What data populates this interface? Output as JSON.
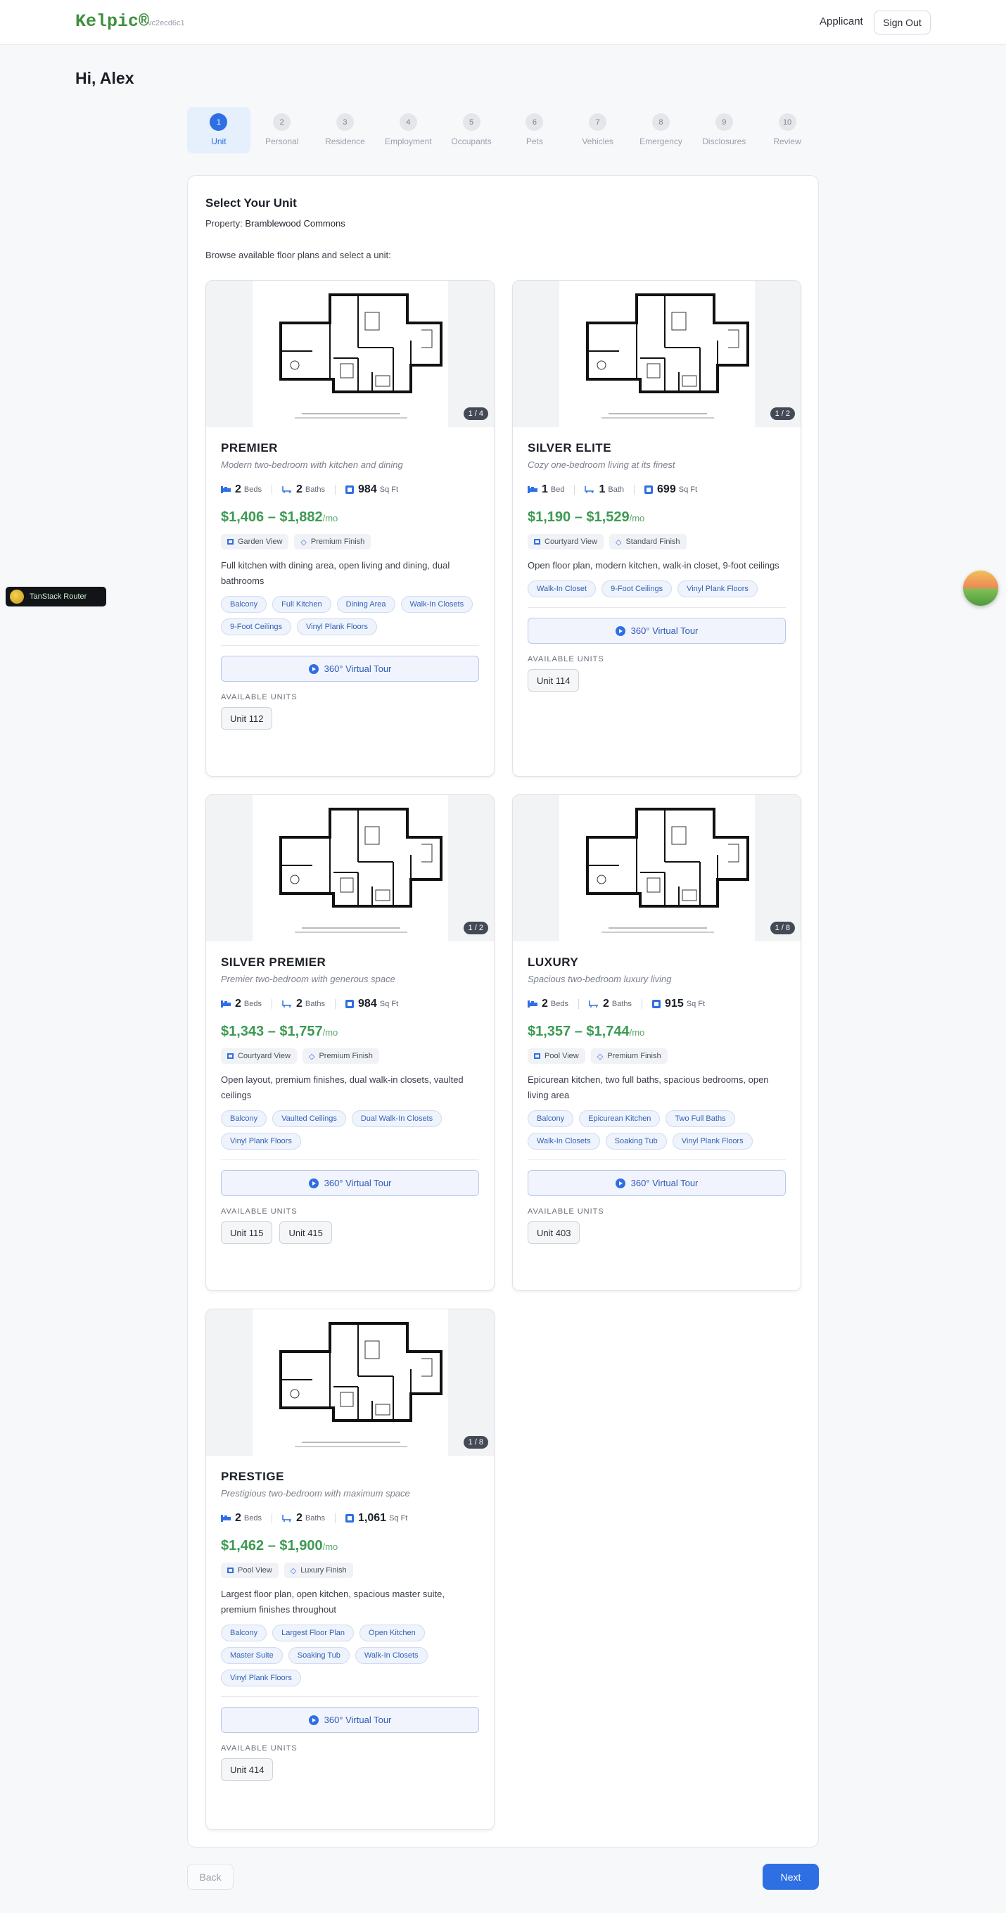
{
  "header": {
    "brand": "Kelpic®",
    "version": "vc2ecd6c1",
    "applicant_label": "Applicant",
    "signout_label": "Sign Out"
  },
  "greeting": "Hi, Alex",
  "steps": [
    {
      "num": "1",
      "label": "Unit"
    },
    {
      "num": "2",
      "label": "Personal"
    },
    {
      "num": "3",
      "label": "Residence"
    },
    {
      "num": "4",
      "label": "Employment"
    },
    {
      "num": "5",
      "label": "Occupants"
    },
    {
      "num": "6",
      "label": "Pets"
    },
    {
      "num": "7",
      "label": "Vehicles"
    },
    {
      "num": "8",
      "label": "Emergency"
    },
    {
      "num": "9",
      "label": "Disclosures"
    },
    {
      "num": "10",
      "label": "Review"
    }
  ],
  "panel": {
    "title": "Select Your Unit",
    "property_label": "Property:",
    "property_name": "Bramblewood Commons",
    "browse_text": "Browse available floor plans and select a unit:"
  },
  "labels": {
    "beds": "Beds",
    "bed": "Bed",
    "baths": "Baths",
    "bath": "Bath",
    "sqft": "Sq Ft",
    "per_month": "/mo",
    "tour": "360° Virtual Tour",
    "available": "AVAILABLE UNITS"
  },
  "cards": [
    {
      "img_count": "1 / 4",
      "name": "PREMIER",
      "tagline": "Modern two-bedroom with kitchen and dining",
      "beds": "2",
      "beds_label": "Beds",
      "baths": "2",
      "baths_label": "Baths",
      "sqft": "984",
      "price": "$1,406 – $1,882",
      "view": "Garden View",
      "finish": "Premium Finish",
      "description": "Full kitchen with dining area, open living and dining, dual bathrooms",
      "amenities": [
        "Balcony",
        "Full Kitchen",
        "Dining Area",
        "Walk-In Closets",
        "9-Foot Ceilings",
        "Vinyl Plank Floors"
      ],
      "units": [
        "Unit 112"
      ]
    },
    {
      "img_count": "1 / 2",
      "name": "SILVER ELITE",
      "tagline": "Cozy one-bedroom living at its finest",
      "beds": "1",
      "beds_label": "Bed",
      "baths": "1",
      "baths_label": "Bath",
      "sqft": "699",
      "price": "$1,190 – $1,529",
      "view": "Courtyard View",
      "finish": "Standard Finish",
      "description": "Open floor plan, modern kitchen, walk-in closet, 9-foot ceilings",
      "amenities": [
        "Walk-In Closet",
        "9-Foot Ceilings",
        "Vinyl Plank Floors"
      ],
      "units": [
        "Unit 114"
      ]
    },
    {
      "img_count": "1 / 2",
      "name": "SILVER PREMIER",
      "tagline": "Premier two-bedroom with generous space",
      "beds": "2",
      "beds_label": "Beds",
      "baths": "2",
      "baths_label": "Baths",
      "sqft": "984",
      "price": "$1,343 – $1,757",
      "view": "Courtyard View",
      "finish": "Premium Finish",
      "description": "Open layout, premium finishes, dual walk-in closets, vaulted ceilings",
      "amenities": [
        "Balcony",
        "Vaulted Ceilings",
        "Dual Walk-In Closets",
        "Vinyl Plank Floors"
      ],
      "units": [
        "Unit 115",
        "Unit 415"
      ]
    },
    {
      "img_count": "1 / 8",
      "name": "LUXURY",
      "tagline": "Spacious two-bedroom luxury living",
      "beds": "2",
      "beds_label": "Beds",
      "baths": "2",
      "baths_label": "Baths",
      "sqft": "915",
      "price": "$1,357 – $1,744",
      "view": "Pool View",
      "finish": "Premium Finish",
      "description": "Epicurean kitchen, two full baths, spacious bedrooms, open living area",
      "amenities": [
        "Balcony",
        "Epicurean Kitchen",
        "Two Full Baths",
        "Walk-In Closets",
        "Soaking Tub",
        "Vinyl Plank Floors"
      ],
      "units": [
        "Unit 403"
      ]
    },
    {
      "img_count": "1 / 8",
      "name": "PRESTIGE",
      "tagline": "Prestigious two-bedroom with maximum space",
      "beds": "2",
      "beds_label": "Beds",
      "baths": "2",
      "baths_label": "Baths",
      "sqft": "1,061",
      "price": "$1,462 – $1,900",
      "view": "Pool View",
      "finish": "Luxury Finish",
      "description": "Largest floor plan, open kitchen, spacious master suite, premium finishes throughout",
      "amenities": [
        "Balcony",
        "Largest Floor Plan",
        "Open Kitchen",
        "Master Suite",
        "Soaking Tub",
        "Walk-In Closets",
        "Vinyl Plank Floors"
      ],
      "units": [
        "Unit 414"
      ]
    }
  ],
  "footer": {
    "back_label": "Back",
    "next_label": "Next"
  },
  "devtools": {
    "router_label": "TanStack Router"
  }
}
